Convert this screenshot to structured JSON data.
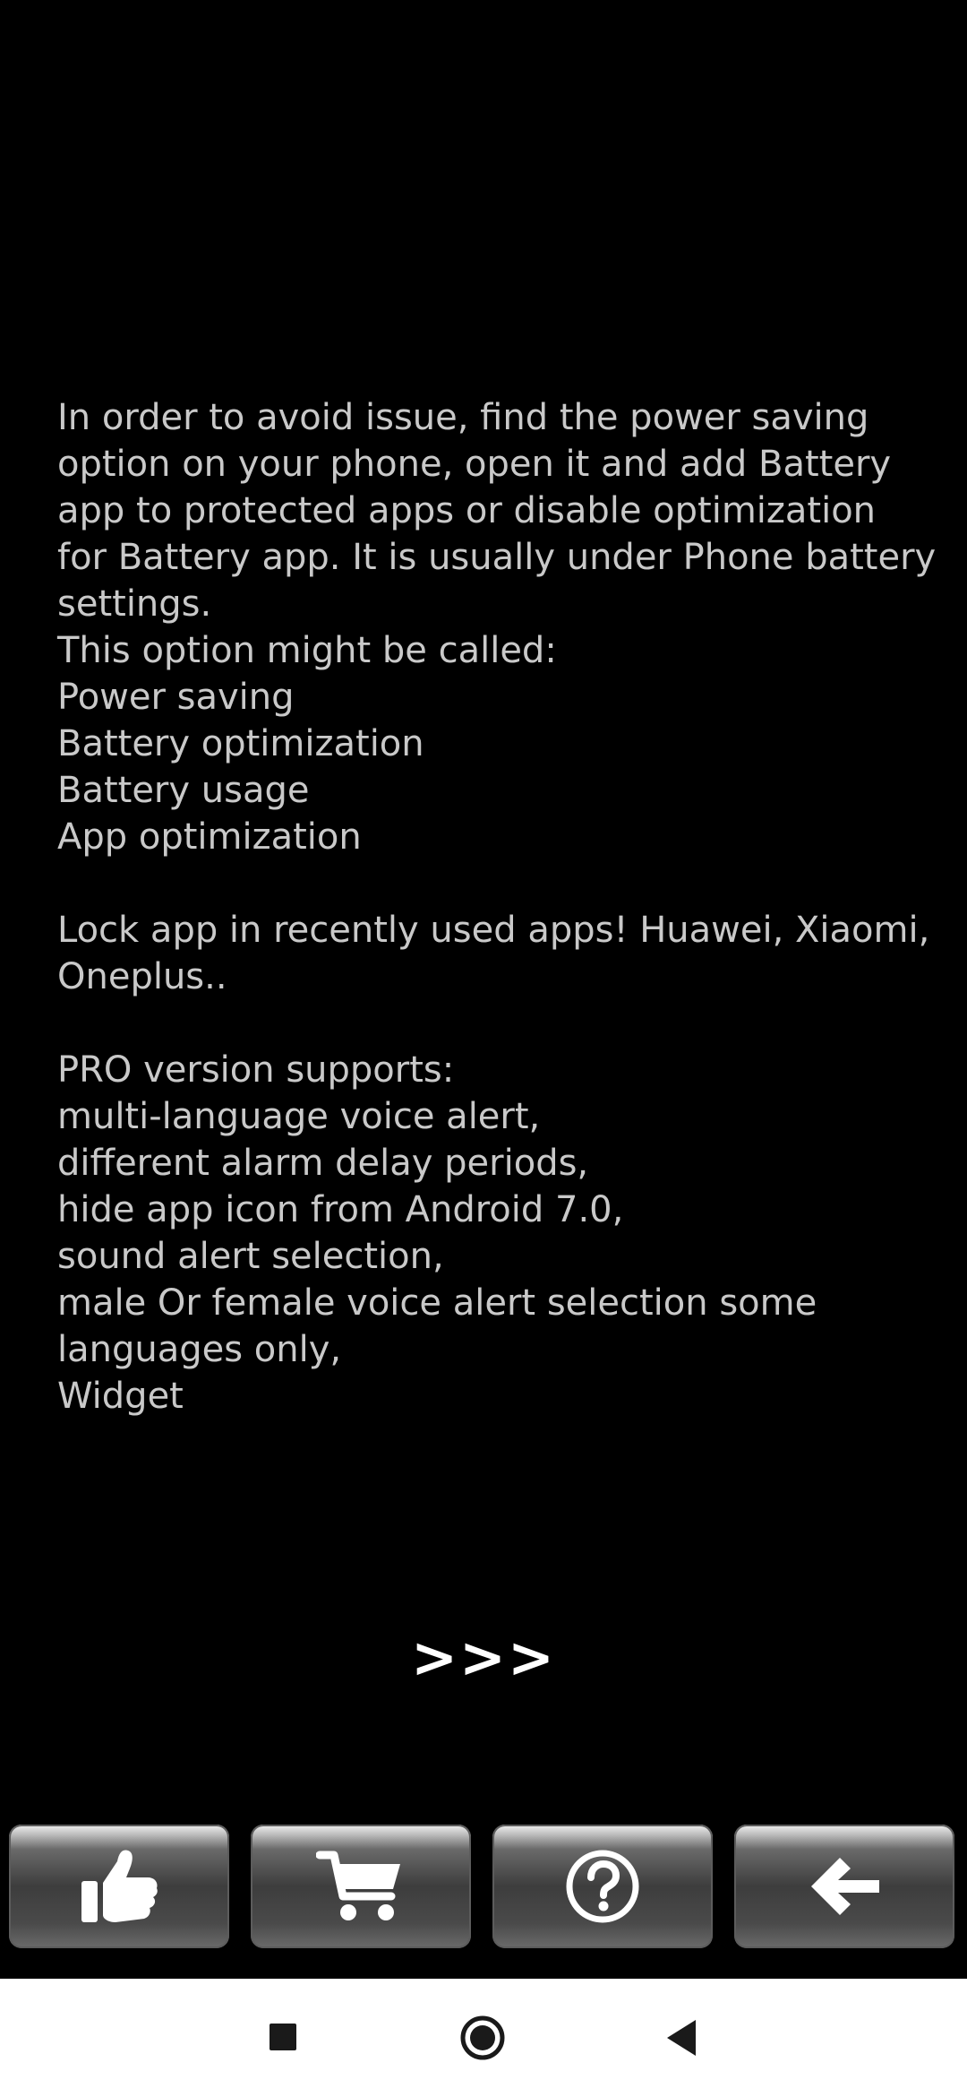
{
  "info": {
    "lines": [
      "In order to avoid issue, find the power saving",
      "option on your phone, open it and add Battery",
      "app to protected apps or disable optimization",
      "for Battery app. It is usually under Phone battery",
      "settings.",
      "This option might be called:",
      "Power saving",
      "Battery optimization",
      "Battery usage",
      "App optimization",
      "",
      "Lock app in recently used apps! Huawei, Xiaomi,",
      "Oneplus..",
      "",
      "PRO version supports:",
      "multi-language voice alert,",
      "different alarm delay periods,",
      "hide app icon from Android 7.0,",
      "sound alert selection,",
      "male Or female voice alert selection some",
      "languages only,",
      "Widget"
    ]
  },
  "next_button": {
    "label": ">>>"
  },
  "toolbar": {
    "buttons": [
      {
        "name": "like-button",
        "icon": "thumbs-up-icon"
      },
      {
        "name": "cart-button",
        "icon": "cart-icon"
      },
      {
        "name": "help-button",
        "icon": "question-icon"
      },
      {
        "name": "back-arrow-button",
        "icon": "arrow-left-icon"
      }
    ]
  },
  "nav_bar": {
    "buttons": [
      {
        "name": "nav-recents-button",
        "icon": "square-icon"
      },
      {
        "name": "nav-home-button",
        "icon": "circle-icon"
      },
      {
        "name": "nav-back-button",
        "icon": "triangle-back-icon"
      }
    ]
  },
  "colors": {
    "background": "#000000",
    "text": "#c9c9c9",
    "accent_text": "#ffffff",
    "nav_bar_background": "#ffffff",
    "nav_icon": "#000000"
  }
}
